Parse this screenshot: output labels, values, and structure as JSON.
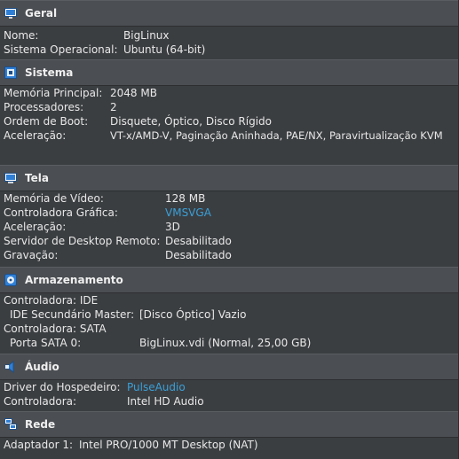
{
  "colors": {
    "header_bg": "#4b4e52",
    "body_bg": "#3b3e41",
    "link": "#3aa0d8",
    "text": "#e8e8e8"
  },
  "sections": {
    "geral": {
      "title": "Geral",
      "icon": "monitor-icon",
      "rows": [
        {
          "label": "Nome:",
          "value": "BigLinux"
        },
        {
          "label": "Sistema Operacional:",
          "value": "Ubuntu (64-bit)"
        }
      ]
    },
    "sistema": {
      "title": "Sistema",
      "icon": "chip-icon",
      "rows": [
        {
          "label": "Memória Principal:",
          "value": "2048 MB"
        },
        {
          "label": "Processadores:",
          "value": "2"
        },
        {
          "label": "Ordem de Boot:",
          "value": "Disquete, Óptico, Disco Rígido"
        },
        {
          "label": "Aceleração:",
          "value": "VT-x/AMD-V, Paginação Aninhada, PAE/NX, Paravirtualização KVM"
        }
      ]
    },
    "tela": {
      "title": "Tela",
      "icon": "display-icon",
      "rows": [
        {
          "label": "Memória de Vídeo:",
          "value": "128 MB"
        },
        {
          "label": "Controladora Gráfica:",
          "value": "VMSVGA"
        },
        {
          "label": "Aceleração:",
          "value": "3D"
        },
        {
          "label": "Servidor de Desktop Remoto:",
          "value": "Desabilitado"
        },
        {
          "label": "Gravação:",
          "value": "Desabilitado"
        }
      ]
    },
    "armazenamento": {
      "title": "Armazenamento",
      "icon": "storage-disk-icon",
      "rows": [
        {
          "label": "Controladora: IDE",
          "value": ""
        },
        {
          "label": "IDE Secundário Master:",
          "value": "[Disco Óptico] Vazio"
        },
        {
          "label": "Controladora: SATA",
          "value": ""
        },
        {
          "label": "Porta SATA 0:",
          "value": "BigLinux.vdi (Normal, 25,00 GB)"
        }
      ]
    },
    "audio": {
      "title": "Áudio",
      "icon": "speaker-icon",
      "rows": [
        {
          "label": "Driver do Hospedeiro:",
          "value": "PulseAudio"
        },
        {
          "label": "Controladora:",
          "value": "Intel HD Audio"
        }
      ]
    },
    "rede": {
      "title": "Rede",
      "icon": "network-icon",
      "rows": [
        {
          "label": "Adaptador 1:",
          "value": "Intel PRO/1000 MT Desktop (NAT)"
        }
      ]
    }
  }
}
